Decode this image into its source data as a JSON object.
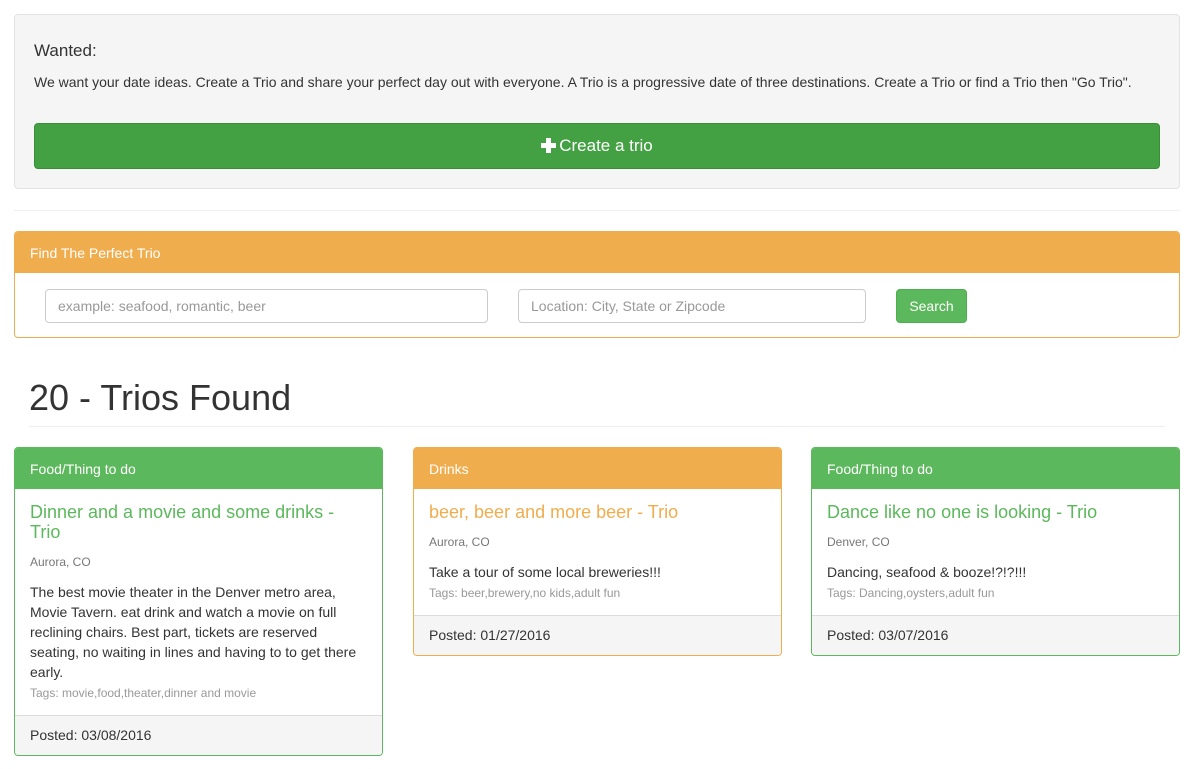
{
  "wanted": {
    "heading": "Wanted:",
    "description": "We want your date ideas. Create a Trio and share your perfect day out with everyone. A Trio is a progressive date of three destinations. Create a Trio or find a Trio then \"Go Trio\".",
    "create_button_label": "Create a trio",
    "create_button_icon": "plus-icon"
  },
  "find": {
    "heading": "Find The Perfect Trio",
    "search_placeholder": "example: seafood, romantic, beer",
    "location_placeholder": "Location: City, State or Zipcode",
    "search_button_label": "Search"
  },
  "results": {
    "title": "20 - Trios Found",
    "cards": [
      {
        "category": "Food/Thing to do",
        "title": "Dinner and a movie and some drinks - Trio",
        "location": "Aurora, CO",
        "description": "The best movie theater in the Denver metro area, Movie Tavern. eat drink and watch a movie on full reclining chairs. Best part, tickets are reserved seating, no waiting in lines and having to to get there early.",
        "tags": "Tags: movie,food,theater,dinner and movie",
        "posted": "Posted: 03/08/2016",
        "color": "#5cb85c"
      },
      {
        "category": "Drinks",
        "title": "beer, beer and more beer - Trio",
        "location": "Aurora, CO",
        "description": "Take a tour of some local breweries!!!",
        "tags": "Tags: beer,brewery,no kids,adult fun",
        "posted": "Posted: 01/27/2016",
        "color": "#f0ad4e"
      },
      {
        "category": "Food/Thing to do",
        "title": "Dance like no one is looking - Trio",
        "location": "Denver, CO",
        "description": "Dancing, seafood & booze!?!?!!!",
        "tags": "Tags: Dancing,oysters,adult fun",
        "posted": "Posted: 03/07/2016",
        "color": "#5cb85c"
      }
    ]
  },
  "colors": {
    "success": "#5cb85c",
    "success_dark": "#43a143",
    "warning": "#f0ad4e"
  }
}
